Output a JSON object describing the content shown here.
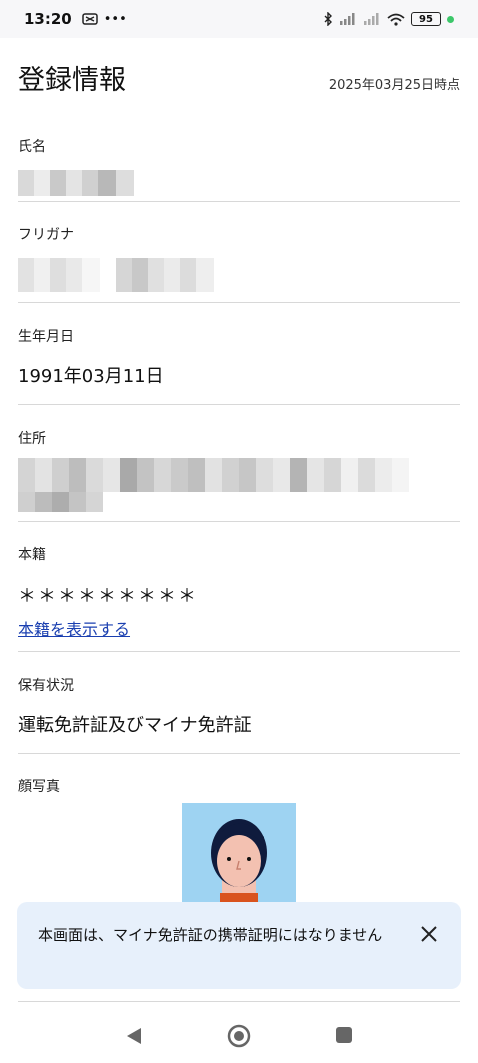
{
  "status_bar": {
    "time": "13:20",
    "battery": "95",
    "icons": [
      "notification-icon",
      "more-icon",
      "bluetooth-icon",
      "signal-icon",
      "signal-icon",
      "wifi-icon",
      "battery-icon"
    ]
  },
  "header": {
    "title": "登録情報",
    "timestamp": "2025年03月25日時点"
  },
  "fields": {
    "name": {
      "label": "氏名",
      "value_redacted": true
    },
    "furigana": {
      "label": "フリガナ",
      "value_redacted": true
    },
    "birthdate": {
      "label": "生年月日",
      "value": "1991年03月11日"
    },
    "address": {
      "label": "住所",
      "value_redacted": true
    },
    "honseki": {
      "label": "本籍",
      "value": "＊＊＊＊＊＊＊＊＊",
      "link": "本籍を表示する"
    },
    "status": {
      "label": "保有状況",
      "value": "運転免許証及びマイナ免許証"
    },
    "photo": {
      "label": "顔写真"
    }
  },
  "toast": {
    "message": "本画面は、マイナ免許証の携帯証明にはなりません"
  },
  "nav": {
    "icons": [
      "back-icon",
      "home-icon",
      "recents-icon"
    ]
  },
  "colors": {
    "link": "#1a3fb0",
    "toast_bg": "#e7f0fb",
    "photo_bg": "#9ed3f2"
  }
}
